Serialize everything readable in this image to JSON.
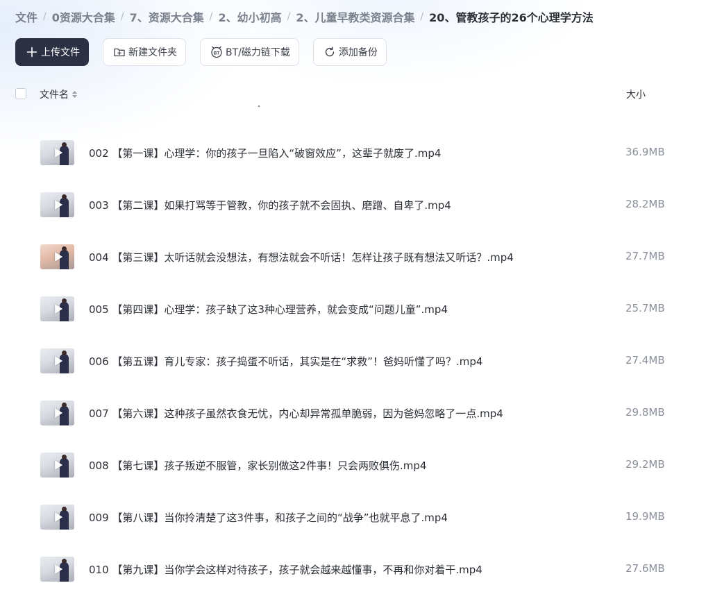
{
  "breadcrumb": [
    "文件",
    "0资源大合集",
    "7、资源大合集",
    "2、幼小初高",
    "2、儿童早教类资源合集",
    "20、管教孩子的26个心理学方法"
  ],
  "toolbar": {
    "upload_label": "上传文件",
    "new_folder_label": "新建文件夹",
    "bt_label": "BT/磁力链下载",
    "backup_label": "添加备份"
  },
  "table_header": {
    "name": "文件名",
    "size": "大小"
  },
  "icons": {
    "upload": "plus-icon",
    "new_folder": "folder-plus-icon",
    "bt": "bt-icon",
    "backup": "refresh-icon",
    "sort": "sort-icon",
    "thumbnail": "play-icon"
  },
  "files": [
    {
      "name": "002 【第一课】心理学：你的孩子一旦陷入“破窗效应”，这辈子就废了.mp4",
      "size": "36.9MB"
    },
    {
      "name": "003 【第二课】如果打骂等于管教，你的孩子就不会固执、磨蹭、自卑了.mp4",
      "size": "28.2MB"
    },
    {
      "name": "004 【第三课】太听话就会没想法，有想法就会不听话！怎样让孩子既有想法又听话？.mp4",
      "size": "27.7MB"
    },
    {
      "name": "005 【第四课】心理学：孩子缺了这3种心理营养，就会变成“问题儿童”.mp4",
      "size": "25.7MB"
    },
    {
      "name": "006 【第五课】育儿专家：孩子捣蛋不听话，其实是在“求救”！爸妈听懂了吗？.mp4",
      "size": "27.4MB"
    },
    {
      "name": "007 【第六课】这种孩子虽然衣食无忧，内心却异常孤单脆弱，因为爸妈忽略了一点.mp4",
      "size": "29.8MB"
    },
    {
      "name": "008 【第七课】孩子叛逆不服管，家长别做这2件事！只会两败俱伤.mp4",
      "size": "29.2MB"
    },
    {
      "name": "009 【第八课】当你拎清楚了这3件事，和孩子之间的“战争”也就平息了.mp4",
      "size": "19.9MB"
    },
    {
      "name": "010 【第九课】当你学会这样对待孩子，孩子就会越来越懂事，不再和你对着干.mp4",
      "size": "27.6MB"
    }
  ]
}
